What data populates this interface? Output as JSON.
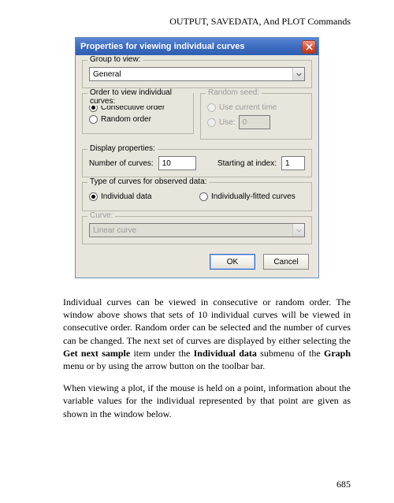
{
  "header": "OUTPUT, SAVEDATA, And PLOT Commands",
  "dialog": {
    "title": "Properties for viewing individual curves",
    "group_to_view": {
      "legend": "Group to view:",
      "selected": "General"
    },
    "order": {
      "legend": "Order to view individual curves:",
      "opt_consecutive": "Consecutive order",
      "opt_random": "Random order"
    },
    "seed": {
      "legend": "Random seed:",
      "opt_current": "Use current time",
      "opt_use": "Use:",
      "use_value": "0"
    },
    "display": {
      "legend": "Display properties:",
      "num_label": "Number of curves:",
      "num_value": "10",
      "start_label": "Starting at index:",
      "start_value": "1"
    },
    "observed": {
      "legend": "Type of curves for observed data:",
      "opt_individual": "Individual data",
      "opt_fitted": "Individually-fitted curves"
    },
    "curve": {
      "legend": "Curve:",
      "selected": "Linear curve"
    },
    "buttons": {
      "ok": "OK",
      "cancel": "Cancel"
    }
  },
  "para1_a": "Individual curves can be viewed in consecutive or random order.  The window above shows that sets of 10 individual curves will be viewed in consecutive order.  Random order can be selected and the number of curves can be changed.  The next set of curves are displayed by either selecting the ",
  "para1_b": "Get next sample",
  "para1_c": " item under the ",
  "para1_d": "Individual data",
  "para1_e": " submenu of the ",
  "para1_f": "Graph",
  "para1_g": " menu or by using the arrow button on the toolbar bar.",
  "para2": "When viewing a plot, if the mouse is held on a point, information about the variable values for the individual represented by that point are given as shown in the window below.",
  "page_number": "685"
}
